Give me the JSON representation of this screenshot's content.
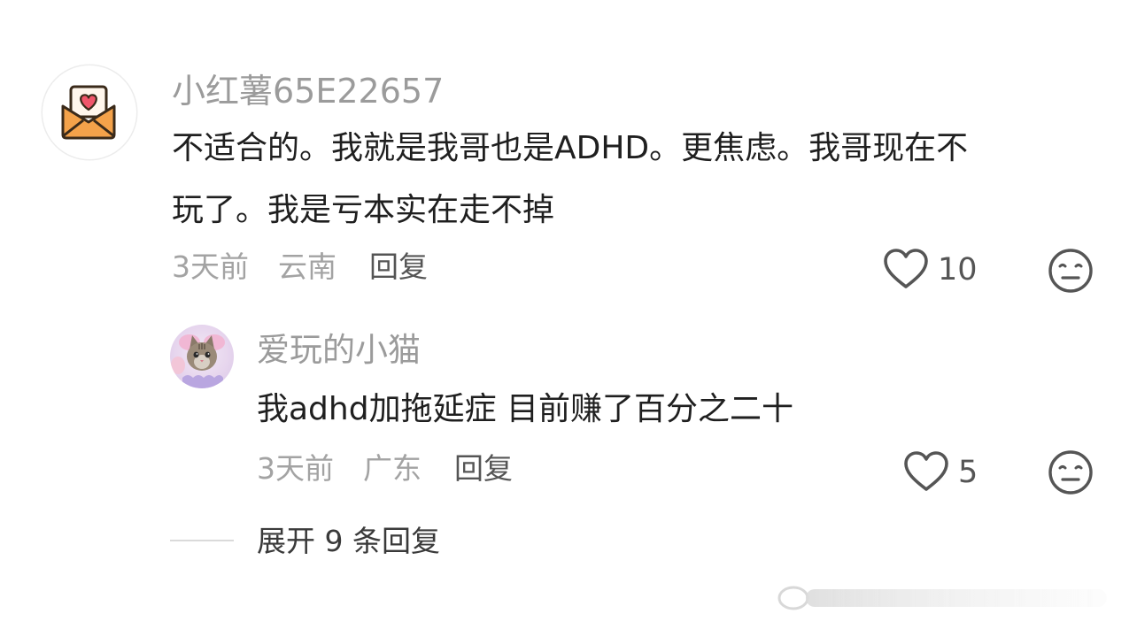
{
  "comment": {
    "username": "小红薯65E22657",
    "avatar_icon": "envelope-heart-icon",
    "text_line1": "不适合的。我就是我哥也是ADHD。更焦虑。我哥现在不",
    "text_line2": "玩了。我是亏本实在走不掉",
    "time": "3天前",
    "location": "云南",
    "reply_label": "回复",
    "likes": "10"
  },
  "reply": {
    "username": "爱玩的小猫",
    "avatar_icon": "cat-avatar",
    "text": "我adhd加拖延症 目前赚了百分之二十",
    "time": "3天前",
    "location": "广东",
    "reply_label": "回复",
    "likes": "5"
  },
  "expand": {
    "label": "展开 9 条回复"
  },
  "colors": {
    "username": "#9b9b9b",
    "body_text": "#1f1f1f",
    "meta": "#a3a3a3",
    "icon": "#555555",
    "avatar_orange": "#f4a24a"
  }
}
